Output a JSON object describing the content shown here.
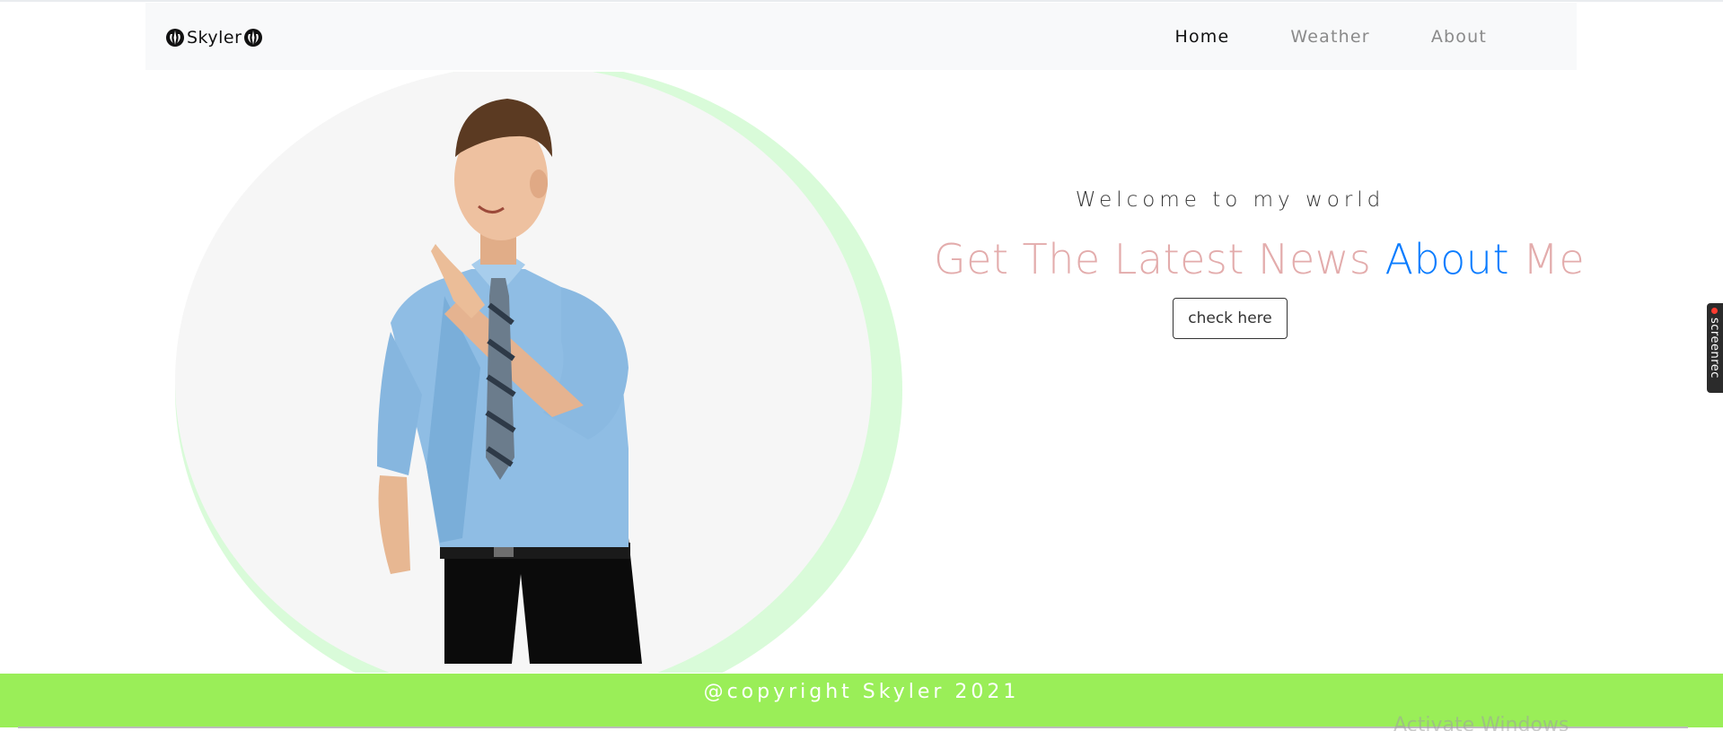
{
  "navbar": {
    "brand": "Skyler",
    "links": [
      {
        "label": "Home",
        "active": true
      },
      {
        "label": "Weather",
        "active": false
      },
      {
        "label": "About",
        "active": false
      }
    ]
  },
  "hero": {
    "welcome": "Welcome to my world",
    "headline_part1": "Get The Latest News",
    "headline_accent": "About",
    "headline_part2": "Me",
    "button_label": "check here"
  },
  "footer": {
    "copyright": "@copyright Skyler 2021"
  },
  "overlay": {
    "watermark": "Activate Windows",
    "screenrec_label": "screenrec"
  },
  "colors": {
    "navbar_bg": "#f8f9fa",
    "headline": "#e3acac",
    "accent": "#0a7cff",
    "footer_bg": "#9aee58",
    "circle_ring": "#d9fbd9",
    "circle_fill": "#f6f6f6"
  },
  "icons": {
    "brand": "jedi-order-icon"
  }
}
